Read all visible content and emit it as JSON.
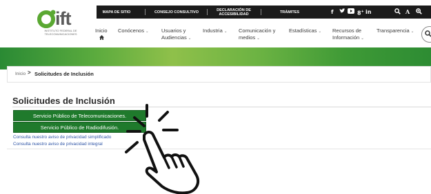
{
  "logo": {
    "wordmark": "ift",
    "tagline": "Instituto Federal de Telecomunicaciones"
  },
  "topbar": {
    "links": [
      "MAPA DE SITIO",
      "CONSEJO CONSULTIVO",
      "DECLARACIÓN DE ACCESIBILIDAD",
      "TRÁMITES"
    ],
    "social": [
      "facebook-icon",
      "twitter-icon",
      "youtube-icon",
      "googleplus-icon",
      "linkedin-icon"
    ],
    "tools": [
      "search-icon",
      "font-size-icon",
      "zoom-icon"
    ]
  },
  "nav": {
    "items": [
      {
        "label": "Inicio",
        "has_home_icon": true
      },
      {
        "label": "Conócenos",
        "dropdown": true
      },
      {
        "label": "Usuarios y Audiencias",
        "dropdown": true
      },
      {
        "label": "Industria",
        "dropdown": true
      },
      {
        "label": "Comunicación y medios",
        "dropdown": true
      },
      {
        "label": "Estadísticas",
        "dropdown": true
      },
      {
        "label": "Recursos de Información",
        "dropdown": true
      },
      {
        "label": "Transparencia",
        "dropdown": true
      }
    ]
  },
  "breadcrumb": {
    "home": "Inicio",
    "separator": ">",
    "current": "Solicitudes de Inclusión"
  },
  "page": {
    "title": "Solicitudes de Inclusión",
    "buttons": [
      "Servicio Público de Telecomunicaciones.",
      "Servicio Público de Radiodifusión."
    ],
    "links": [
      "Consulta nuestro aviso de privacidad simplificado",
      "Consulta nuestro aviso de privacidad integral"
    ]
  },
  "colors": {
    "brand_green": "#1f7a2c",
    "topbar_black": "#1b1b1b",
    "link_blue": "#2f55a6"
  },
  "overlay": {
    "icon": "pointing-hand-click-icon"
  }
}
